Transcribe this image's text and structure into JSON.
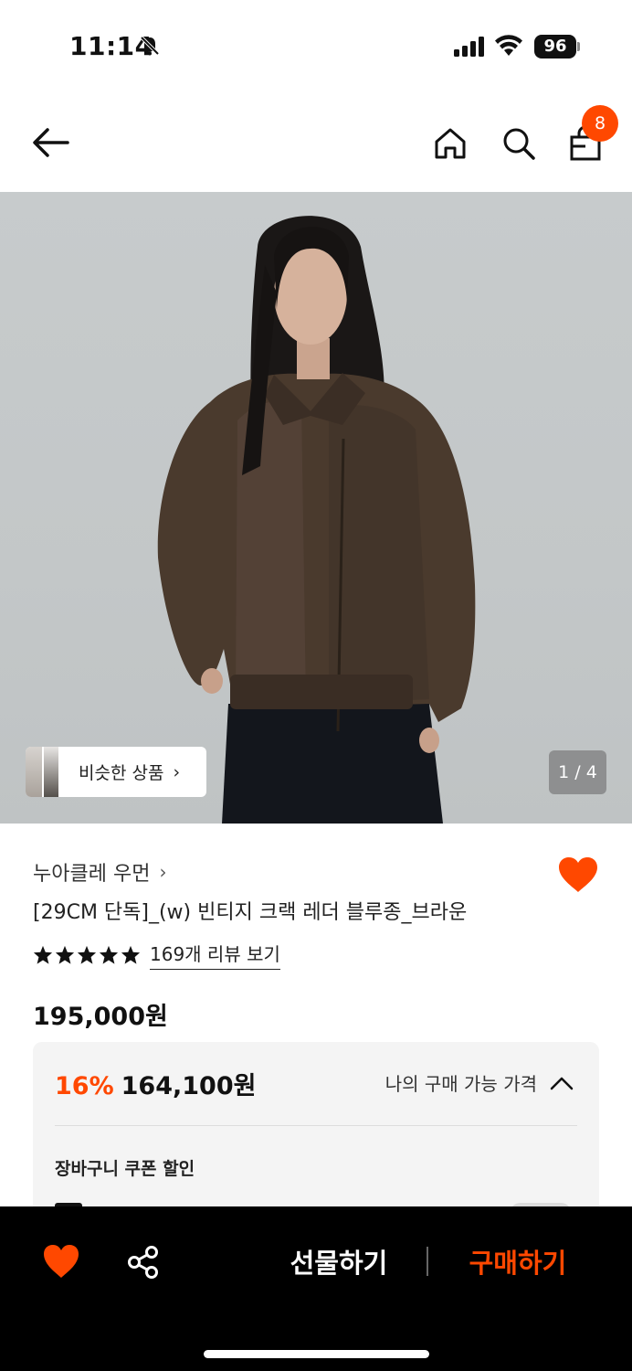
{
  "status_bar": {
    "time": "11:14",
    "battery": "96"
  },
  "navbar": {
    "cart_count": "8",
    "icons": [
      "back-arrow-icon",
      "home-icon",
      "search-icon",
      "shopping-bag-icon"
    ]
  },
  "hero": {
    "similar_label": "비슷한 상품",
    "page_indicator": "1 / 4"
  },
  "product": {
    "brand": "누아클레 우먼",
    "title": "[29CM 단독]_(w) 빈티지 크랙 레더 블루종_브라운",
    "rating_stars": 5,
    "review_link": "169개 리뷰 보기",
    "original_price": "195,000원",
    "discount_rate": "16%",
    "final_price": "164,100원",
    "my_price_label": "나의 구매 가능 가격",
    "coupon_label": "장바구니 쿠폰 할인"
  },
  "bottom_bar": {
    "gift_label": "선물하기",
    "buy_label": "구매하기"
  },
  "colors": {
    "accent": "#ff4800",
    "heart": "#ff4800",
    "bottom_bar_bg": "#000000"
  }
}
